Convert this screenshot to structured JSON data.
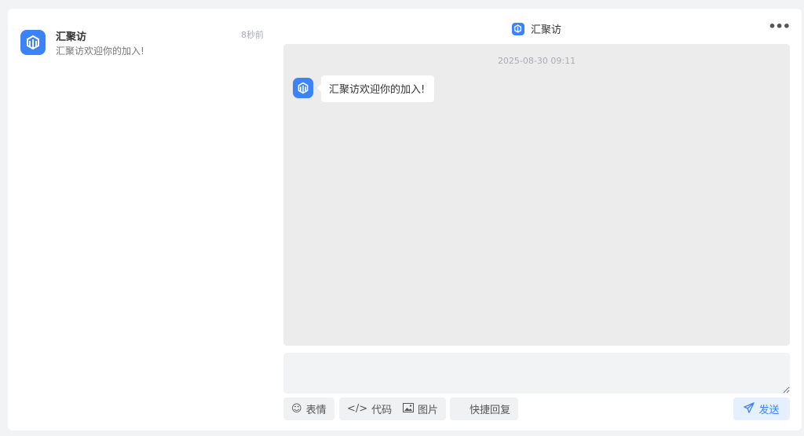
{
  "conversation": {
    "name": "汇聚访",
    "time": "8秒前",
    "preview": "汇聚访欢迎你的加入!"
  },
  "chat": {
    "title": "汇聚访",
    "more_icon": "more-horizontal-icon",
    "message_time": "2025-08-30 09:11",
    "messages": [
      {
        "sender": "汇聚访",
        "text": "汇聚访欢迎你的加入!"
      }
    ]
  },
  "composer": {
    "value": "",
    "toolbar": {
      "emoji_label": "表情",
      "code_label": "代码",
      "image_label": "图片",
      "quick_reply_label": "快捷回复"
    },
    "send_label": "发送"
  },
  "colors": {
    "accent": "#3b83f6",
    "message_area_bg": "#ececed",
    "page_bg": "#f2f3f5"
  }
}
